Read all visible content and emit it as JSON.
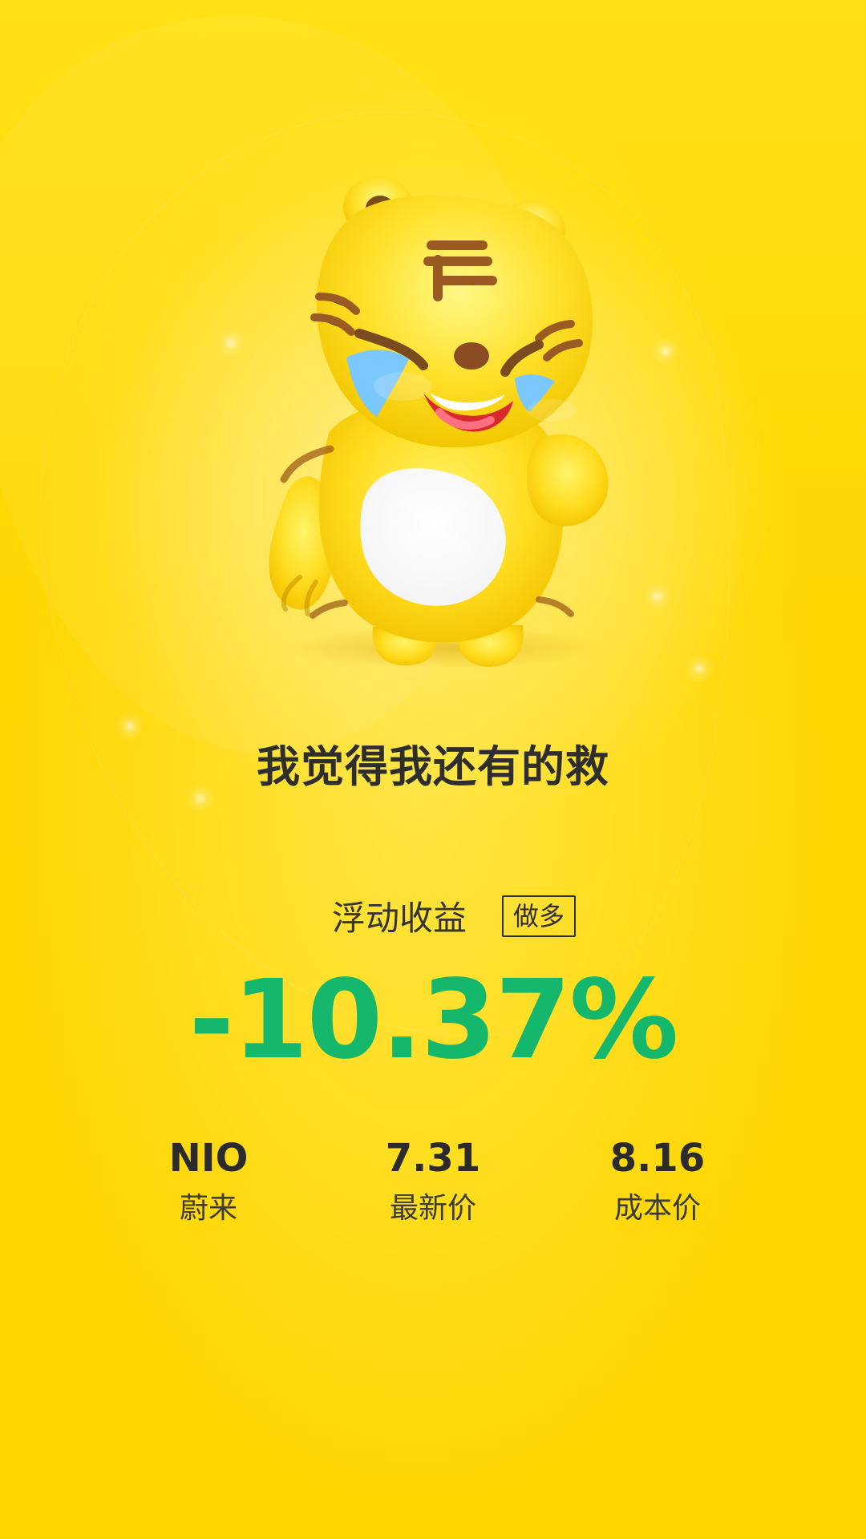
{
  "headline": "我觉得我还有的救",
  "position": {
    "floating_label": "浮动收益",
    "direction_badge": "做多",
    "percent_change": "-10.37%"
  },
  "stats": [
    {
      "value": "NIO",
      "label": "蔚来"
    },
    {
      "value": "7.31",
      "label": "最新价"
    },
    {
      "value": "8.16",
      "label": "成本价"
    }
  ],
  "colors": {
    "background": "#ffd600",
    "text_dark": "#2e2e2e",
    "loss_green": "#15b76c"
  },
  "illustration": {
    "name": "crying tiger mascot"
  }
}
